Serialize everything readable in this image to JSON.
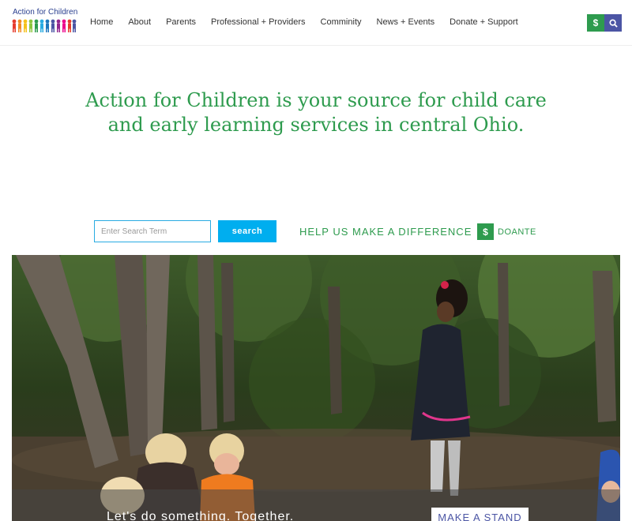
{
  "header": {
    "logo_text": "Action for Children",
    "nav": [
      {
        "label": "Home"
      },
      {
        "label": "About"
      },
      {
        "label": "Parents"
      },
      {
        "label": "Professional + Providers"
      },
      {
        "label": "Comminity"
      },
      {
        "label": "News + Events"
      },
      {
        "label": "Donate + Support"
      }
    ],
    "dollar_icon": "$",
    "search_icon": "search-icon"
  },
  "hero": {
    "headline": "Action for Children is your source for child care and early learning services in central Ohio."
  },
  "search": {
    "placeholder": "Enter Search Term",
    "button_label": "search"
  },
  "help": {
    "text": "HELP US MAKE A DIFFERENCE",
    "donate_icon": "$",
    "donate_label": "DOANTE"
  },
  "photo": {
    "caption": "Let's do something. Together.",
    "cta_label": "MAKE A STAND"
  },
  "colors": {
    "green": "#2e9b4e",
    "purple": "#4b55a4",
    "cyan": "#00aeef"
  }
}
